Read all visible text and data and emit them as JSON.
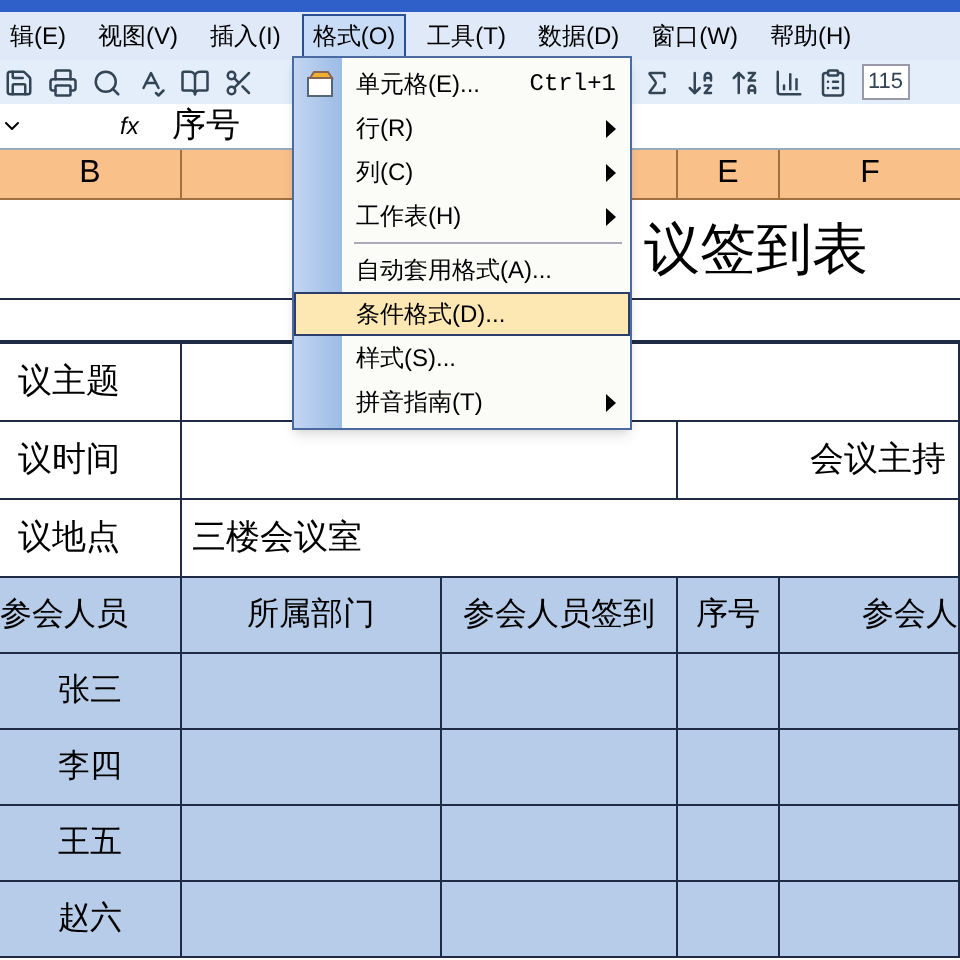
{
  "menu_bar": [
    {
      "label": "辑(E)",
      "selected": false
    },
    {
      "label": "视图(V)",
      "selected": false
    },
    {
      "label": "插入(I)",
      "selected": false
    },
    {
      "label": "格式(O)",
      "selected": true
    },
    {
      "label": "工具(T)",
      "selected": false
    },
    {
      "label": "数据(D)",
      "selected": false
    },
    {
      "label": "窗口(W)",
      "selected": false
    },
    {
      "label": "帮助(H)",
      "selected": false
    }
  ],
  "toolbar": {
    "zoom": "115"
  },
  "formula_bar": {
    "fx": "fx",
    "value": "序号"
  },
  "column_headers": [
    {
      "label": "B"
    },
    {
      "label": "E"
    },
    {
      "label": "F"
    }
  ],
  "sheet": {
    "title": "议签到表",
    "info_rows": [
      {
        "label": "议主题",
        "value": "",
        "extra": ""
      },
      {
        "label": "议时间",
        "value": "",
        "extra": "会议主持"
      },
      {
        "label": "议地点",
        "value": "三楼会议室",
        "extra": ""
      }
    ],
    "table_header": [
      "参会人员",
      "所属部门",
      "参会人员签到",
      "序号",
      "参会人"
    ],
    "rows": [
      [
        "张三"
      ],
      [
        "李四"
      ],
      [
        "王五"
      ],
      [
        "赵六"
      ]
    ]
  },
  "format_menu": [
    {
      "kind": "item",
      "label": "单元格(E)...",
      "shortcut": "Ctrl+1",
      "icon": true,
      "submenu": false,
      "selected": false
    },
    {
      "kind": "item",
      "label": "行(R)",
      "submenu": true,
      "selected": false
    },
    {
      "kind": "item",
      "label": "列(C)",
      "submenu": true,
      "selected": false
    },
    {
      "kind": "item",
      "label": "工作表(H)",
      "submenu": true,
      "selected": false
    },
    {
      "kind": "separator"
    },
    {
      "kind": "item",
      "label": "自动套用格式(A)...",
      "submenu": false,
      "selected": false
    },
    {
      "kind": "item",
      "label": "条件格式(D)...",
      "submenu": false,
      "selected": true
    },
    {
      "kind": "item",
      "label": "样式(S)...",
      "submenu": false,
      "selected": false
    },
    {
      "kind": "item",
      "label": "拼音指南(T)",
      "submenu": true,
      "selected": false
    }
  ]
}
